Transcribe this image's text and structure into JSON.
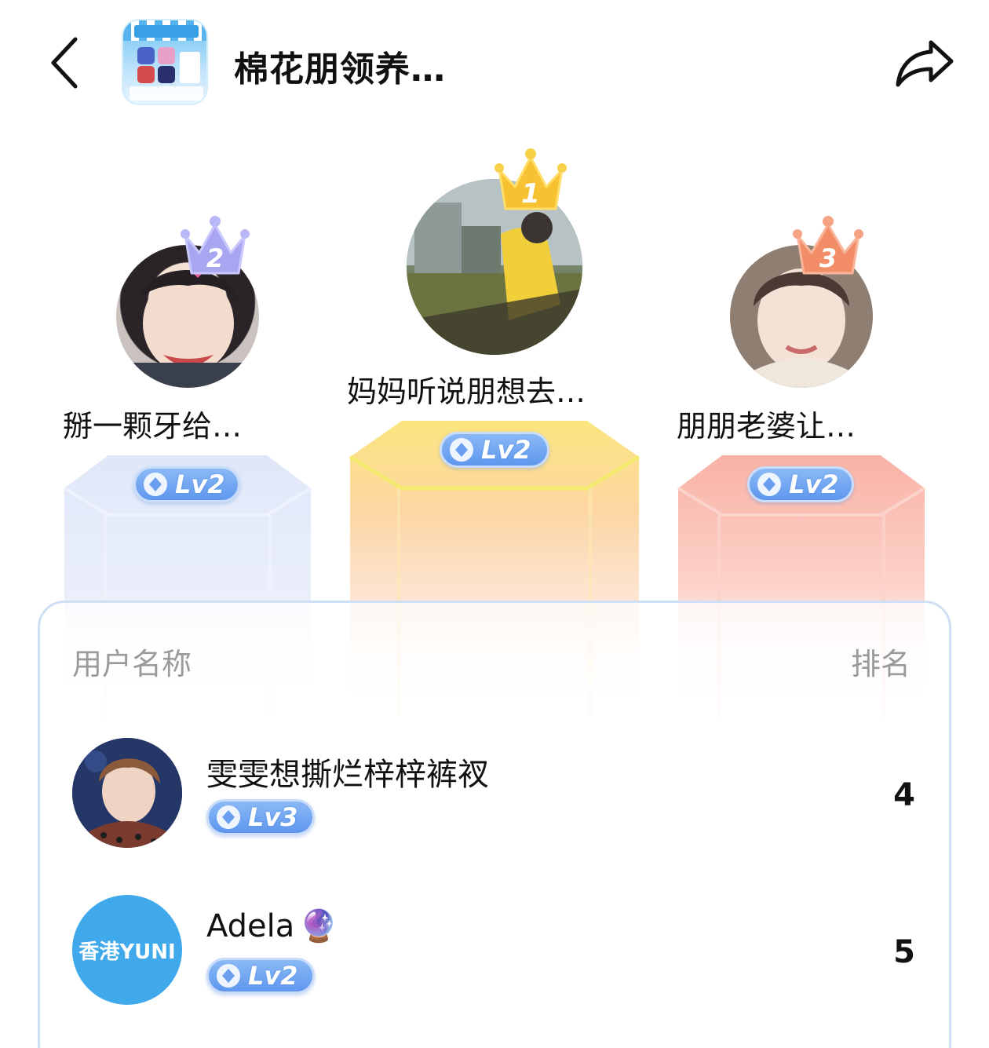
{
  "header": {
    "back_icon": "chevron-left-icon",
    "title": "棉花朋领养…",
    "share_icon": "share-arrow-icon"
  },
  "podium": [
    {
      "rank": "1",
      "name": "妈妈听说朋想去…",
      "level": "Lv2",
      "crown_color": "#f5b92e"
    },
    {
      "rank": "2",
      "name": "掰一颗牙给…",
      "level": "Lv2",
      "crown_color": "#9e9cf0"
    },
    {
      "rank": "3",
      "name": "朋朋老婆让…",
      "level": "Lv2",
      "crown_color": "#f08a6a"
    }
  ],
  "table": {
    "col_user": "用户名称",
    "col_rank": "排名",
    "rows": [
      {
        "name": "雯雯想撕烂梓梓裤衩",
        "level": "Lv3",
        "rank": "4"
      },
      {
        "name": "Adela",
        "name_emoji": "🔮",
        "avatar_text": "香港YUNI",
        "level": "Lv2",
        "rank": "5"
      }
    ]
  },
  "colors": {
    "level_badge": "#6a9ff0",
    "pillar_silver": "#d9e3f7",
    "pillar_gold": "#fbe07a",
    "pillar_bronze": "#f7a9a0",
    "avatar_blue": "#3fa9ec"
  }
}
